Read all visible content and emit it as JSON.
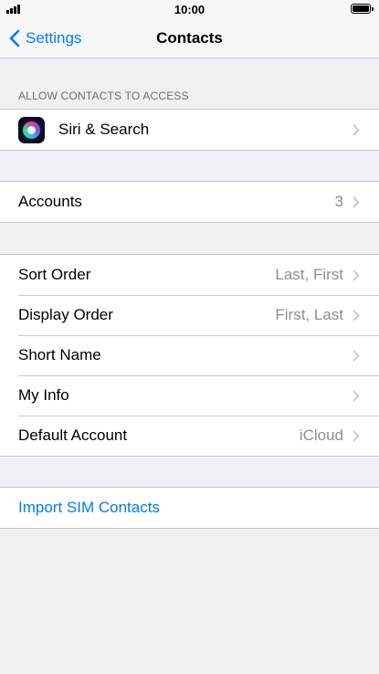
{
  "status_bar": {
    "time": "10:00"
  },
  "nav": {
    "back_label": "Settings",
    "title": "Contacts"
  },
  "sections": {
    "allow_access_header": "ALLOW CONTACTS TO ACCESS",
    "siri": {
      "label": "Siri & Search",
      "icon": "siri-icon"
    },
    "accounts": {
      "label": "Accounts",
      "value": "3"
    },
    "sort_order": {
      "label": "Sort Order",
      "value": "Last, First"
    },
    "display_order": {
      "label": "Display Order",
      "value": "First, Last"
    },
    "short_name": {
      "label": "Short Name"
    },
    "my_info": {
      "label": "My Info"
    },
    "default_account": {
      "label": "Default Account",
      "value": "iCloud"
    },
    "import_sim": {
      "label": "Import SIM Contacts"
    }
  },
  "colors": {
    "accent": "#007aff",
    "background": "#efeff4",
    "secondary_text": "#8e8e93"
  }
}
